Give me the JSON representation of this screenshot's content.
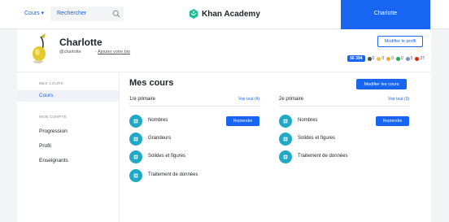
{
  "topbar": {
    "courses_menu": "Cours ▾",
    "search_placeholder": "Rechercher",
    "logo_text": "Khan Academy",
    "user_name": "Charlotte"
  },
  "profile": {
    "name": "Charlotte",
    "handle": "@charlotte",
    "bio_prefix": "- ",
    "bio_link": "Ajouter votre bio",
    "edit_label": "Modifier le profil",
    "points": "56 394",
    "badges": [
      {
        "color": "#4a4a4a",
        "count": "0"
      },
      {
        "color": "#e8c23a",
        "count": "0"
      },
      {
        "color": "#f1a43a",
        "count": "0"
      },
      {
        "color": "#1fab54",
        "count": "0"
      },
      {
        "color": "#7b8ed6",
        "count": "5"
      },
      {
        "color": "#d92916",
        "count": "37"
      }
    ]
  },
  "sidebar": {
    "section1": "MES COURS",
    "courses_item": "Cours",
    "section2": "MON COMPTE",
    "items": [
      "Progression",
      "Profil",
      "Enseignants"
    ]
  },
  "main": {
    "title": "Mes cours",
    "edit_label": "Modifier les cours",
    "resume_label": "Reprendre",
    "columns": [
      {
        "title": "1re primaire",
        "link": "Voir tout (4)",
        "courses": [
          "Nombres",
          "Grandeurs",
          "Solides et figures",
          "Traitement de données"
        ]
      },
      {
        "title": "2e primaire",
        "link": "Voir tout (3)",
        "courses": [
          "Nombres",
          "Solides et figures",
          "Traitement de données"
        ]
      }
    ]
  },
  "colors": {
    "accent": "#1865f2",
    "course_icon": "#1fa9c6",
    "logo": "#14bf96"
  }
}
